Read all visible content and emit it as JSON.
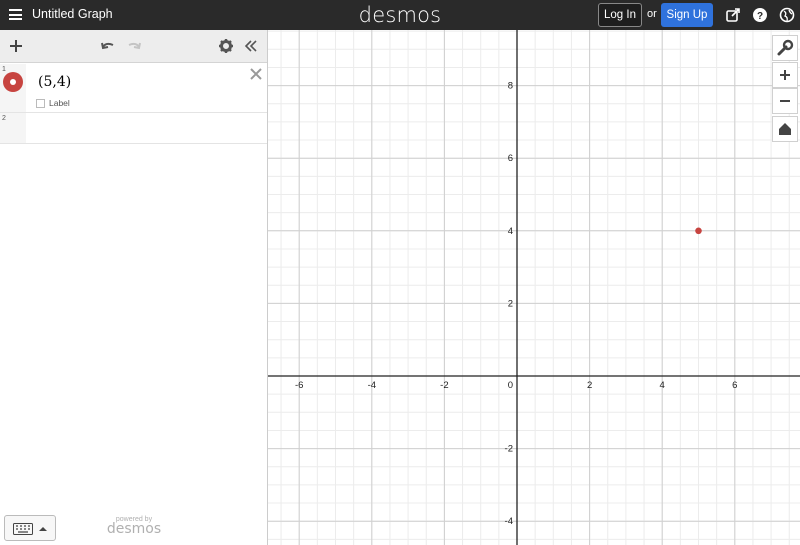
{
  "header": {
    "title": "Untitled Graph",
    "brand": "desmos",
    "login_label": "Log In",
    "or_label": "or",
    "signup_label": "Sign Up",
    "icons": [
      "menu-icon",
      "share-icon",
      "help-icon",
      "language-icon"
    ]
  },
  "toolbar": {
    "icons": [
      "add-icon",
      "undo-icon",
      "redo-icon",
      "settings-icon",
      "collapse-icon"
    ]
  },
  "expressions": [
    {
      "number": "1",
      "latex": "(5,4)",
      "color": "#c74440",
      "label_option": "Label"
    },
    {
      "number": "2",
      "latex": ""
    }
  ],
  "footer": {
    "powered_by": "powered by",
    "brand": "desmos",
    "keyboard_icon": "keyboard-icon"
  },
  "graph": {
    "x_ticks": [
      "-6",
      "-4",
      "-2",
      "0",
      "2",
      "4",
      "6"
    ],
    "y_ticks": [
      "8",
      "6",
      "4",
      "2",
      "-2",
      "-4"
    ],
    "grid": true,
    "points": [
      {
        "x": 5,
        "y": 4,
        "color": "#c74440"
      }
    ],
    "side_controls": [
      "wrench-icon",
      "zoom-in-icon",
      "zoom-out-icon",
      "home-icon"
    ]
  },
  "colors": {
    "header_bg": "#2a2a2a",
    "signup_bg": "#2f72dc",
    "point": "#c74440"
  }
}
